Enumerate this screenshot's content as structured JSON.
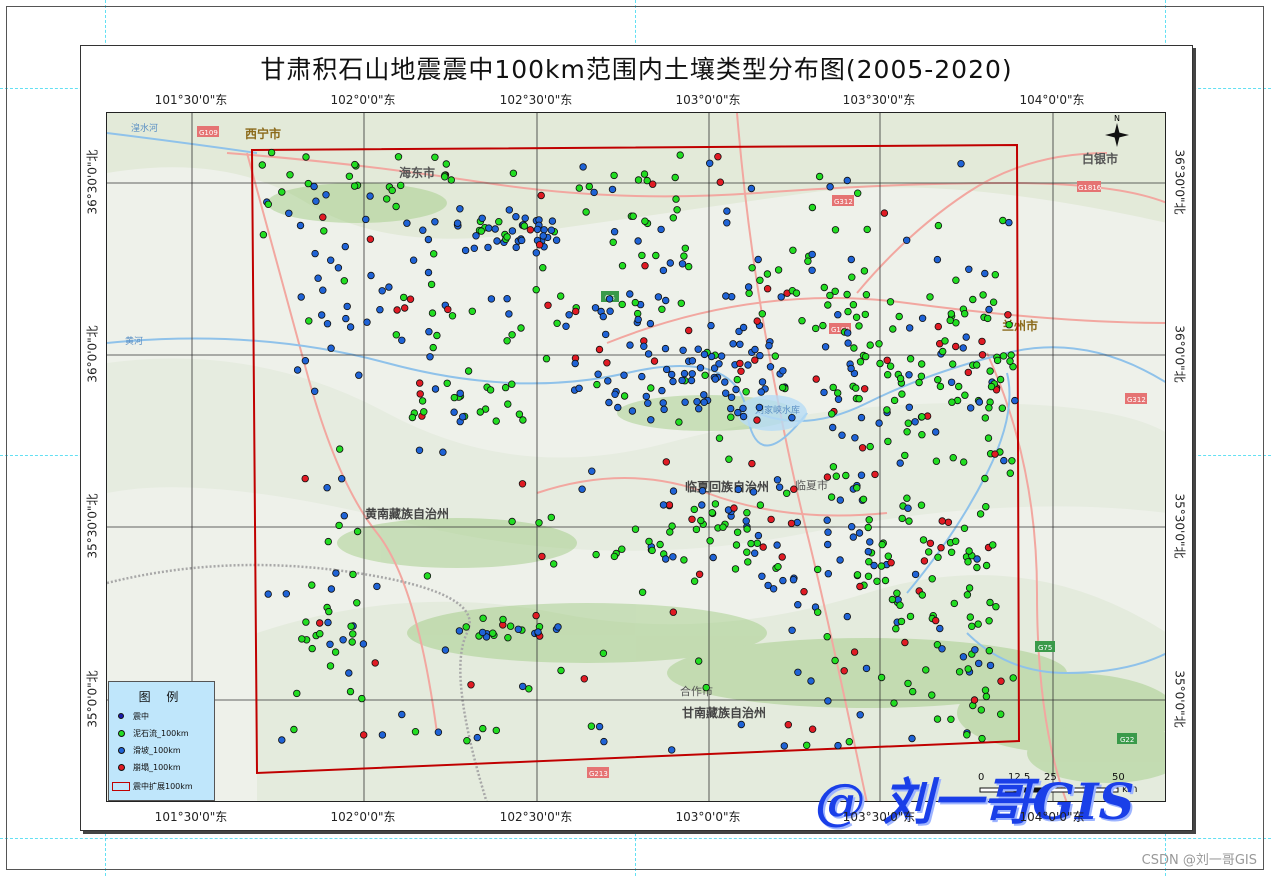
{
  "title": "甘肃积石山地震震中100km范围内土壤类型分布图(2005-2020)",
  "longitude_labels": [
    "101°30'0\"东",
    "102°0'0\"东",
    "102°30'0\"东",
    "103°0'0\"东",
    "103°30'0\"东",
    "104°0'0\"东"
  ],
  "latitude_labels": [
    "36°30'0\"北",
    "36°0'0\"北",
    "35°30'0\"北",
    "35°0'0\"北"
  ],
  "place_labels": {
    "xining": "西宁市",
    "haidong": "海东市",
    "baiyin": "白银市",
    "lanzhou": "兰州市",
    "huanghe": "黄河",
    "huangshui": "湟水河",
    "reservoir": "刘家峡水库",
    "linxia_pref": "临夏回族自治州",
    "linxia_city": "临夏市",
    "hainan": "黄南藏族自治州",
    "hezuo": "合作市",
    "gannan": "甘南藏族自治州"
  },
  "road_labels": [
    "G109",
    "G312",
    "G109",
    "G312",
    "G75",
    "G22",
    "G6",
    "G1816",
    "G213"
  ],
  "legend": {
    "title": "图 例",
    "items": [
      {
        "label": "震中",
        "symbol": "epicenter"
      },
      {
        "label": "泥石流_100km",
        "symbol": "green-dot",
        "color": "#22dd22"
      },
      {
        "label": "滑坡_100km",
        "symbol": "blue-dot",
        "color": "#1f63d6"
      },
      {
        "label": "崩塌_100km",
        "symbol": "red-dot",
        "color": "#e01b24"
      },
      {
        "label": "震中扩展100km",
        "symbol": "red-rect",
        "color": "#c00000"
      }
    ]
  },
  "scale_bar": {
    "ticks": [
      "0",
      "12.5",
      "25",
      "50"
    ],
    "unit": "km"
  },
  "north_arrow": "N",
  "watermark": "@ 刘一哥GIS",
  "csdn_credit": "CSDN @刘一哥GIS",
  "colors": {
    "mudflow": "#22dd22",
    "landslide": "#1f63d6",
    "collapse": "#e01b24",
    "buffer": "#c00000",
    "legend_bg": "#bfe6fb"
  }
}
